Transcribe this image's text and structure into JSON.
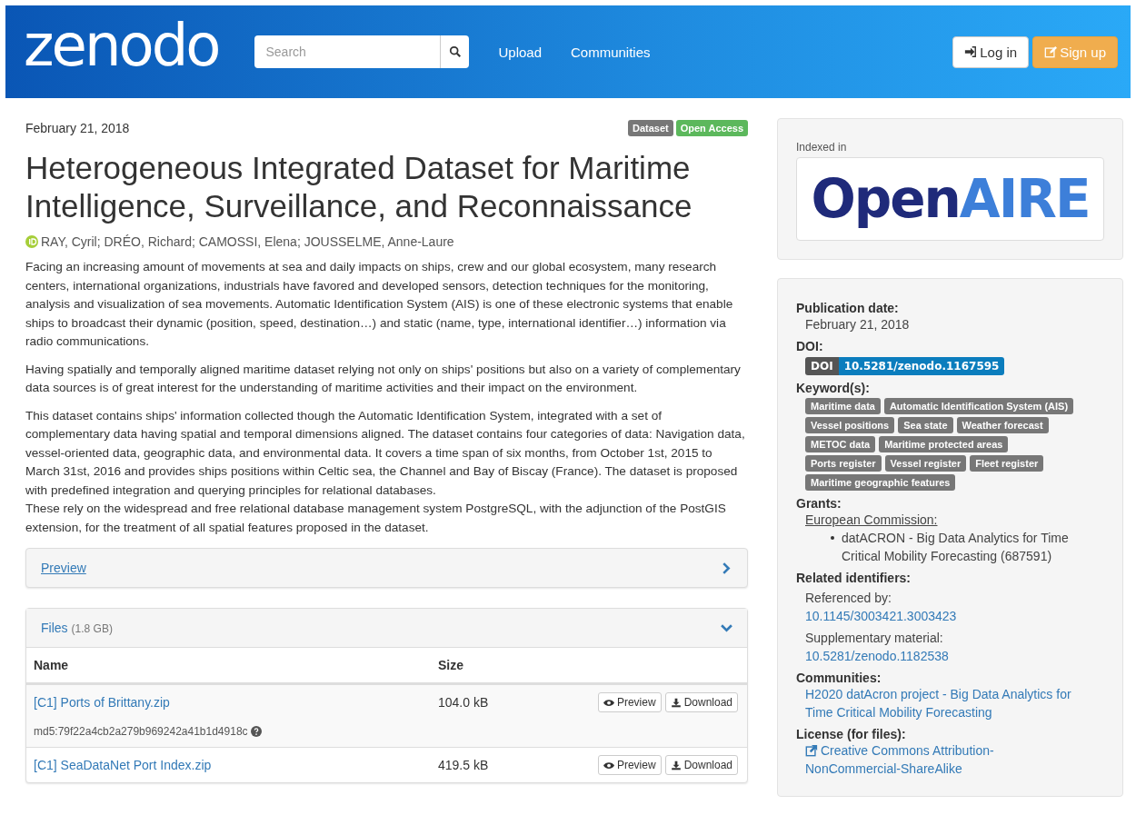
{
  "header": {
    "logo": "zenodo",
    "search": {
      "placeholder": "Search"
    },
    "nav": [
      "Upload",
      "Communities"
    ],
    "login": "Log in",
    "signup": "Sign up"
  },
  "record": {
    "date": "February 21, 2018",
    "badges": [
      {
        "label": "Dataset",
        "color": "#777777"
      },
      {
        "label": "Open Access",
        "color": "#5cb85c"
      }
    ],
    "title": "Heterogeneous Integrated Dataset for Maritime Intelligence, Surveillance, and Reconnaissance",
    "authors": "RAY, Cyril; DRÉO, Richard; CAMOSSI, Elena; JOUSSELME, Anne-Laure",
    "paragraphs": [
      "Facing an increasing amount of movements at sea and daily impacts on ships, crew and our global ecosystem, many research centers, international organizations, industrials have favored and developed sensors, detection techniques for the monitoring, analysis and visualization of sea movements. Automatic Identification System (AIS) is one of these electronic systems that enable ships to broadcast their dynamic (position, speed, destination…) and static (name, type, international identifier…) information via radio communications.",
      "Having spatially and temporally aligned maritime dataset relying not only on ships' positions but also on a variety of complementary data sources is of great interest for the understanding of maritime activities and their impact on the environment.",
      "This dataset contains ships' information collected though the Automatic Identification System, integrated with a set of complementary data having spatial and temporal dimensions aligned. The dataset contains four categories of data: Navigation data, vessel-oriented data, geographic data, and environmental data. It covers a time span of six months, from October 1st, 2015 to March 31st, 2016 and provides ships positions within Celtic sea, the Channel and Bay of Biscay (France).  The dataset is proposed with predefined integration and querying principles for relational databases.\nThese rely on the widespread and free relational database management system PostgreSQL, with the adjunction of the PostGIS extension, for the treatment of all spatial features proposed in the dataset."
    ]
  },
  "preview_panel": {
    "label": "Preview",
    "expanded": false
  },
  "files_panel": {
    "label": "Files",
    "size": "(1.8 GB)",
    "expanded": true,
    "columns": [
      "Name",
      "Size"
    ],
    "rows": [
      {
        "name": "[C1] Ports of Brittany.zip",
        "size": "104.0 kB",
        "preview": "Preview",
        "download": "Download",
        "md5": "md5:79f22a4cb2a279b969242a41b1d4918c"
      },
      {
        "name": "[C1] SeaDataNet Port Index.zip",
        "size": "419.5 kB",
        "preview": "Preview",
        "download": "Download"
      }
    ]
  },
  "indexed": {
    "label": "Indexed in",
    "logo_parts": [
      {
        "text": "Open",
        "color": "#1f2a7a"
      },
      {
        "text": "AIRE",
        "color": "#3d7fd9"
      }
    ]
  },
  "details": {
    "publication_date_label": "Publication date:",
    "publication_date": "February 21, 2018",
    "doi_label": "DOI:",
    "doi_tag": "DOI",
    "doi": "10.5281/zenodo.1167595",
    "keywords_label": "Keyword(s):",
    "keywords": [
      "Maritime data",
      "Automatic Identification System (AIS)",
      "Vessel positions",
      "Sea state",
      "Weather forecast",
      "METOC data",
      "Maritime protected areas",
      "Ports register",
      "Vessel register",
      "Fleet register",
      "Maritime geographic features"
    ],
    "grants_label": "Grants:",
    "funder": "European Commission:",
    "grants": [
      "datACRON - Big Data Analytics for Time Critical Mobility Forecasting (687591)"
    ],
    "related_label": "Related identifiers:",
    "related": [
      {
        "relation": "Referenced by:",
        "id": "10.1145/3003421.3003423"
      },
      {
        "relation": "Supplementary material:",
        "id": "10.5281/zenodo.1182538"
      }
    ],
    "communities_label": "Communities:",
    "communities": [
      "H2020 datAcron project - Big Data Analytics for Time Critical Mobility Forecasting"
    ],
    "license_label": "License (for files):",
    "license": "Creative Commons Attribution-NonCommercial-ShareAlike"
  }
}
